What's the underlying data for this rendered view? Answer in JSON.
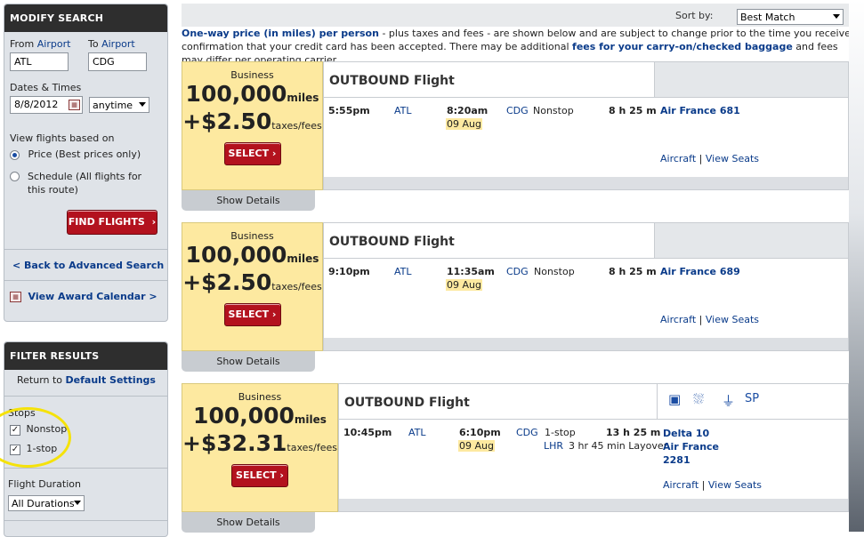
{
  "modify_search": {
    "title": "MODIFY SEARCH",
    "from_label": "From",
    "from_link": "Airport",
    "from_value": "ATL",
    "to_label": "To",
    "to_link": "Airport",
    "to_value": "CDG",
    "dates_label": "Dates & Times",
    "date_value": "8/8/2012",
    "time_value": "anytime",
    "view_label": "View flights based on",
    "opt_price": "Price (Best prices only)",
    "opt_schedule": "Schedule (All flights for this route)",
    "find_button": "FIND FLIGHTS",
    "back_link": "< Back to Advanced Search",
    "calendar_link": "View Award Calendar >"
  },
  "filter": {
    "title": "FILTER RESULTS",
    "return_text": "Return to",
    "default_link": "Default Settings",
    "stops_label": "Stops",
    "nonstop": "Nonstop",
    "one_stop": "1-stop",
    "duration_label": "Flight Duration",
    "duration_value": "All Durations"
  },
  "sort": {
    "label": "Sort by:",
    "value": "Best Match"
  },
  "notice": {
    "bold1": "One-way price (in miles) per person",
    "text1": " - plus taxes and fees - are shown below and are subject to change prior to the time you receive confirmation that your credit card has been accepted. There may be additional ",
    "bold2": "fees for your carry-on/checked baggage",
    "text2": " and fees may differ per operating carrier."
  },
  "flights": [
    {
      "cabin": "Business",
      "miles": "100,000",
      "miles_unit": "miles",
      "tax": "+$2.50",
      "tax_unit": "taxes/fees",
      "select": "SELECT",
      "heading": "OUTBOUND Flight",
      "depart_time": "5:55pm",
      "depart_airport": "ATL",
      "arrive_time": "8:20am",
      "arrive_date": "09 Aug",
      "arrive_airport": "CDG",
      "stops": "Nonstop",
      "duration": "8 h 25 m",
      "flight": "Air France 681",
      "aircraft": "Aircraft",
      "seats": "View Seats",
      "show_details": "Show Details"
    },
    {
      "cabin": "Business",
      "miles": "100,000",
      "miles_unit": "miles",
      "tax": "+$2.50",
      "tax_unit": "taxes/fees",
      "select": "SELECT",
      "heading": "OUTBOUND Flight",
      "depart_time": "9:10pm",
      "depart_airport": "ATL",
      "arrive_time": "11:35am",
      "arrive_date": "09 Aug",
      "arrive_airport": "CDG",
      "stops": "Nonstop",
      "duration": "8 h 25 m",
      "flight": "Air France 689",
      "aircraft": "Aircraft",
      "seats": "View Seats",
      "show_details": "Show Details"
    },
    {
      "cabin": "Business",
      "miles": "100,000",
      "miles_unit": "miles",
      "tax": "+$32.31",
      "tax_unit": "taxes/fees",
      "select": "SELECT",
      "heading": "OUTBOUND Flight",
      "depart_time": "10:45pm",
      "depart_airport": "ATL",
      "arrive_time": "6:10pm",
      "arrive_date": "09 Aug",
      "arrive_airport": "CDG",
      "stops": "1-stop",
      "via_airport": "LHR",
      "layover": "3 hr 45 min Layover",
      "duration": "13 h 25 m",
      "flight_line1": "Delta 10",
      "flight_line2": "Air France",
      "flight_line3": "2281",
      "amenity_sp": "SP",
      "aircraft": "Aircraft",
      "seats": "View Seats",
      "show_details": "Show Details"
    }
  ],
  "colors": {
    "brand_red": "#b3121e",
    "price_yellow": "#fde9a0",
    "link_blue": "#0a3b8a",
    "highlight_circle": "#f5e20a"
  }
}
